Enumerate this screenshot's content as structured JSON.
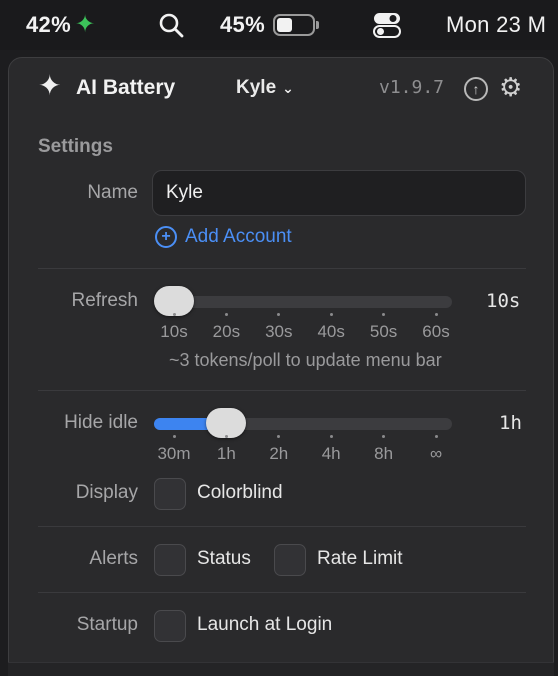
{
  "menubar": {
    "usage_percent": "42%",
    "battery_percent": "45%",
    "battery_level": 0.45,
    "datetime": "Mon 23 M",
    "accent": "#3cc35a"
  },
  "header": {
    "app_title": "AI Battery",
    "account": "Kyle",
    "version": "v1.9.7"
  },
  "settings": {
    "section_title": "Settings",
    "name_label": "Name",
    "name_value": "Kyle",
    "add_account": "Add Account",
    "refresh": {
      "label": "Refresh",
      "value": "10s",
      "ticks": [
        "10s",
        "20s",
        "30s",
        "40s",
        "50s",
        "60s"
      ],
      "hint": "~3 tokens/poll to update menu bar"
    },
    "hide_idle": {
      "label": "Hide idle",
      "value": "1h",
      "ticks": [
        "30m",
        "1h",
        "2h",
        "4h",
        "8h",
        "∞"
      ]
    },
    "display": {
      "label": "Display",
      "option": "Colorblind"
    },
    "alerts": {
      "label": "Alerts",
      "option_status": "Status",
      "option_rate": "Rate Limit"
    },
    "startup": {
      "label": "Startup",
      "option": "Launch at Login"
    }
  },
  "colors": {
    "accent_blue": "#3d84f0",
    "link_blue": "#4b8ff5"
  }
}
